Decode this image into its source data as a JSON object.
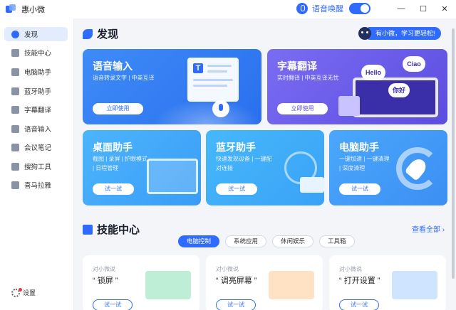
{
  "app": {
    "title": "惠小微"
  },
  "titlebar": {
    "wake_label": "语音唤醒",
    "wake_enabled": true,
    "minimize": "—",
    "maximize": "☐",
    "close": "✕"
  },
  "sidebar": {
    "items": [
      {
        "label": "发现",
        "icon": "discover-icon",
        "active": true
      },
      {
        "label": "技能中心",
        "icon": "skills-icon"
      },
      {
        "label": "电脑助手",
        "icon": "computer-icon"
      },
      {
        "label": "蓝牙助手",
        "icon": "bluetooth-icon"
      },
      {
        "label": "字幕翻译",
        "icon": "subtitle-icon"
      },
      {
        "label": "语音输入",
        "icon": "voice-icon"
      },
      {
        "label": "会议笔记",
        "icon": "notes-icon"
      },
      {
        "label": "搜狗工具",
        "icon": "tools-icon"
      },
      {
        "label": "喜马拉雅",
        "icon": "ximalaya-icon"
      }
    ],
    "settings_label": "设置"
  },
  "discover": {
    "title": "发现",
    "greeting": "有小微，学习更轻松!",
    "cards": {
      "voice": {
        "title": "语音输入",
        "sub": "语音转录文字 | 中英互译",
        "btn": "立即使用"
      },
      "subtitle": {
        "title": "字幕翻译",
        "sub": "实时翻译 | 中英互译无忧",
        "btn": "立即使用",
        "bubbles": [
          "Hello",
          "Ciao",
          "你好"
        ]
      },
      "desktop": {
        "title": "桌面助手",
        "sub1": "截图 | 录屏 | 护眼模式",
        "sub2": "| 日程管理",
        "btn": "试一试"
      },
      "bluetooth": {
        "title": "蓝牙助手",
        "sub1": "快速发现设备 | 一键配",
        "sub2": "对连接",
        "btn": "试一试"
      },
      "pc": {
        "title": "电脑助手",
        "sub1": "一键加速 | 一键清理",
        "sub2": "| 深度清理",
        "btn": "试一试"
      }
    }
  },
  "skills": {
    "title": "技能中心",
    "view_all": "查看全部 ›",
    "tabs": [
      {
        "label": "电脑控制",
        "active": true
      },
      {
        "label": "系统应用"
      },
      {
        "label": "休闲娱乐"
      },
      {
        "label": "工具箱"
      }
    ],
    "cards": [
      {
        "say": "对小微说",
        "phrase": "“ 锁屏 ”",
        "btn": "试一试"
      },
      {
        "say": "对小微说",
        "phrase": "“ 调亮屏幕 ”",
        "btn": "试一试"
      },
      {
        "say": "对小微说",
        "phrase": "“ 打开设置 ”",
        "btn": "试一试"
      }
    ]
  },
  "colors": {
    "accent": "#2f6bff",
    "purple": "#6a5cf0",
    "background": "#f3f5f9"
  }
}
